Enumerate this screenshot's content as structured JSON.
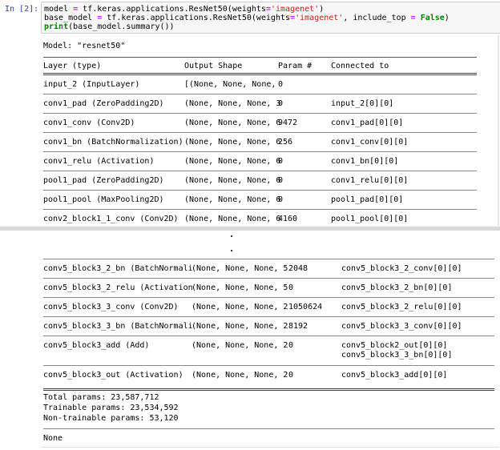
{
  "cell": {
    "prompt": "In [2]:",
    "code_lines": [
      {
        "parts": [
          {
            "t": "model ",
            "c": ""
          },
          {
            "t": "=",
            "c": "op"
          },
          {
            "t": " tf.keras.applications.ResNet50(weights",
            "c": ""
          },
          {
            "t": "=",
            "c": "op"
          },
          {
            "t": "'imagenet'",
            "c": "str"
          },
          {
            "t": ")",
            "c": ""
          }
        ]
      },
      {
        "parts": [
          {
            "t": "base_model ",
            "c": ""
          },
          {
            "t": "=",
            "c": "op"
          },
          {
            "t": " tf.keras.applications.ResNet50(weights",
            "c": ""
          },
          {
            "t": "=",
            "c": "op"
          },
          {
            "t": "'imagenet'",
            "c": "str"
          },
          {
            "t": ", include_top ",
            "c": ""
          },
          {
            "t": "=",
            "c": "op"
          },
          {
            "t": " ",
            "c": ""
          },
          {
            "t": "False",
            "c": "kw"
          },
          {
            "t": ")",
            "c": ""
          }
        ]
      },
      {
        "parts": [
          {
            "t": "print",
            "c": "kw"
          },
          {
            "t": "(base_model.summary())",
            "c": ""
          }
        ]
      }
    ]
  },
  "summary": {
    "model_title": "Model: \"resnet50\"",
    "headers": {
      "layer": "Layer (type)",
      "output_shape": "Output Shape",
      "param": "Param #",
      "connected": "Connected to"
    },
    "top_rows": [
      {
        "layer": "input_2 (InputLayer)",
        "shape": "[(None, None, None,",
        "param": "0",
        "connected": ""
      },
      {
        "layer": "conv1_pad (ZeroPadding2D)",
        "shape": "(None, None, None, 3",
        "param": "0",
        "connected": "input_2[0][0]"
      },
      {
        "layer": "conv1_conv (Conv2D)",
        "shape": "(None, None, None, 6",
        "param": "9472",
        "connected": "conv1_pad[0][0]"
      },
      {
        "layer": "conv1_bn (BatchNormalization)",
        "shape": "(None, None, None, 6",
        "param": "256",
        "connected": "conv1_conv[0][0]"
      },
      {
        "layer": "conv1_relu (Activation)",
        "shape": "(None, None, None, 6",
        "param": "0",
        "connected": "conv1_bn[0][0]"
      },
      {
        "layer": "pool1_pad (ZeroPadding2D)",
        "shape": "(None, None, None, 6",
        "param": "0",
        "connected": "conv1_relu[0][0]"
      },
      {
        "layer": "pool1_pool (MaxPooling2D)",
        "shape": "(None, None, None, 6",
        "param": "0",
        "connected": "pool1_pad[0][0]"
      },
      {
        "layer": "conv2_block1_1_conv (Conv2D)",
        "shape": "(None, None, None, 6",
        "param": "4160",
        "connected": "pool1_pool[0][0]"
      }
    ],
    "bottom_rows": [
      {
        "layer": "conv5_block3_2_bn (BatchNormali",
        "shape": "(None, None, None, 5",
        "param": "2048",
        "connected": "conv5_block3_2_conv[0][0]"
      },
      {
        "layer": "conv5_block3_2_relu (Activation",
        "shape": "(None, None, None, 5",
        "param": "0",
        "connected": "conv5_block3_2_bn[0][0]"
      },
      {
        "layer": "conv5_block3_3_conv (Conv2D)",
        "shape": "(None, None, None, 2",
        "param": "1050624",
        "connected": "conv5_block3_2_relu[0][0]"
      },
      {
        "layer": "conv5_block3_3_bn (BatchNormali",
        "shape": "(None, None, None, 2",
        "param": "8192",
        "connected": "conv5_block3_3_conv[0][0]"
      },
      {
        "layer": "conv5_block3_add (Add)",
        "shape": "(None, None, None, 2",
        "param": "0",
        "connected": "conv5_block2_out[0][0]",
        "connected2": "conv5_block3_3_bn[0][0]"
      },
      {
        "layer": "conv5_block3_out (Activation)",
        "shape": "(None, None, None, 2",
        "param": "0",
        "connected": "conv5_block3_add[0][0]"
      }
    ],
    "totals": {
      "total": "Total params: 23,587,712",
      "trainable": "Trainable params: 23,534,592",
      "non_trainable": "Non-trainable params: 53,120"
    },
    "return_value": "None"
  },
  "colors": {
    "prompt": "#303f9f",
    "code_bg": "#f7f7f7",
    "string": "#ba2121",
    "keyword": "#008000",
    "operator": "#aa22ff"
  }
}
